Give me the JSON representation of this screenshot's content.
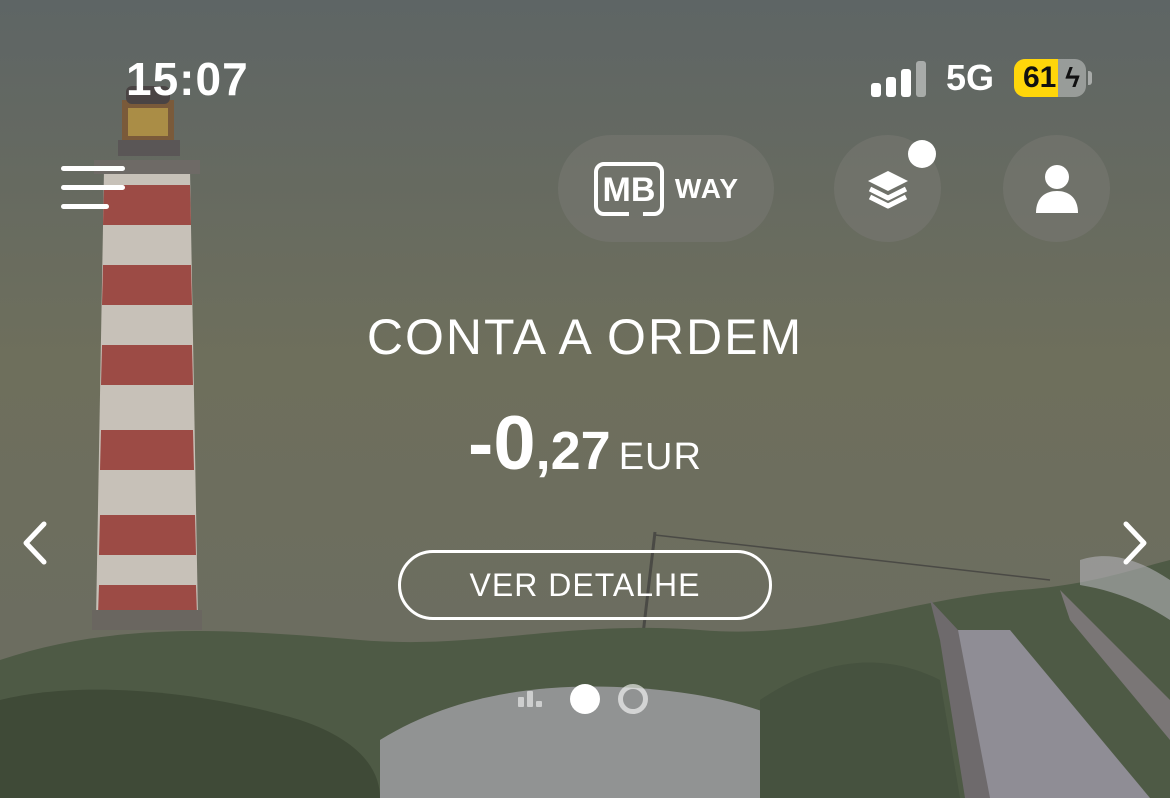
{
  "status_bar": {
    "time": "15:07",
    "network": "5G",
    "battery_level": "61",
    "battery_color": "#ffd60a",
    "charging": true
  },
  "header": {
    "menu_icon": "hamburger-menu-icon",
    "mbway_logo_text": "MB",
    "mbway_label": "WAY",
    "layers_icon": "layers-icon",
    "profile_icon": "user-icon",
    "has_notification": true
  },
  "account": {
    "title": "CONTA A ORDEM",
    "balance_main": "-0",
    "balance_cents": ",27",
    "currency": "EUR"
  },
  "actions": {
    "detail_label": "VER DETALHE",
    "prev_icon": "chevron-left-icon",
    "next_icon": "chevron-right-icon"
  },
  "pager": {
    "icons": [
      "bar-chart-icon",
      "dot-active",
      "dot-inactive"
    ],
    "active_index": 1
  }
}
